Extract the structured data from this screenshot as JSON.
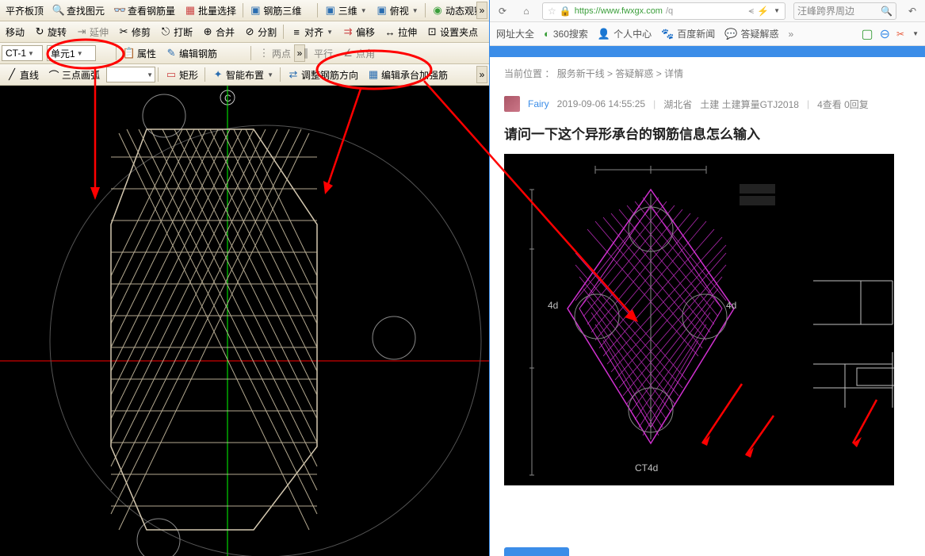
{
  "toolbars": {
    "row1": {
      "items": [
        "平齐板顶",
        "查找图元",
        "查看钢筋量",
        "批量选择",
        "钢筋三维"
      ],
      "dd_3d": "三维",
      "dd_view": "俯视",
      "dynamic": "动态观察"
    },
    "row2": {
      "items": [
        "移动",
        "旋转",
        "延伸",
        "修剪",
        "打断",
        "合并",
        "分割",
        "对齐",
        "偏移",
        "拉伸",
        "设置夹点"
      ]
    },
    "row3": {
      "ct": "CT-1",
      "unit": "单元1",
      "props": "属性",
      "edit_rebar": "编辑钢筋",
      "two_point": "两点",
      "parallel": "平行",
      "point_angle": "点角"
    },
    "row4": {
      "line": "直线",
      "arc": "三点画弧",
      "rect": "矩形",
      "smart": "智能布置",
      "adjust": "调整钢筋方向",
      "edit_cap": "编辑承台加强筋"
    }
  },
  "browser": {
    "url_host": "https://www.fwxgx.com",
    "url_path": "/q",
    "search_placeholder": "汪峰跨界周边",
    "bookmarks": [
      "网址大全",
      "360搜索",
      "个人中心",
      "百度新闻",
      "答疑解惑"
    ]
  },
  "breadcrumb": {
    "label": "当前位置 ：",
    "items": [
      "服务新干线",
      "答疑解惑",
      "详情"
    ]
  },
  "post": {
    "user": "Fairy",
    "time": "2019-09-06 14:55:25",
    "loc": "湖北省",
    "cat": "土建 土建算量GTJ2018",
    "stats": "4查看  0回复",
    "title": "请问一下这个异形承台的钢筋信息怎么输入",
    "img_label": "CT4d"
  }
}
